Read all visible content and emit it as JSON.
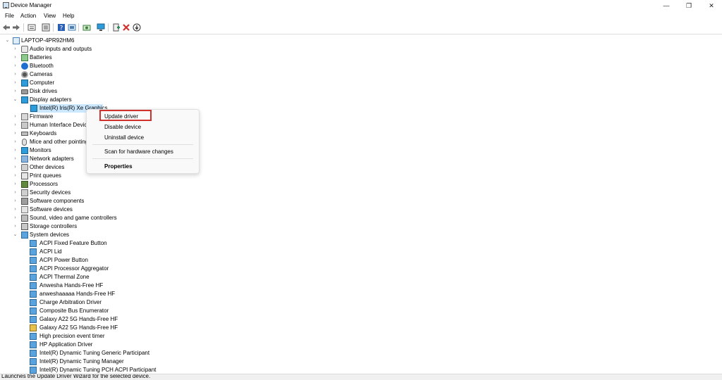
{
  "window": {
    "title": "Device Manager",
    "minimize": "—",
    "restore": "❐",
    "close": "✕"
  },
  "menu": [
    "File",
    "Action",
    "View",
    "Help"
  ],
  "toolbar": [
    "back-arrow-icon",
    "forward-arrow-icon",
    "properties-icon",
    "list-view-icon",
    "help-icon",
    "device-view-icon",
    "scan-icon",
    "monitor-icon",
    "add-driver-icon",
    "remove-device-icon",
    "download-icon"
  ],
  "tree": {
    "root": "LAPTOP-4PR92HM6",
    "categories": [
      {
        "label": "Audio inputs and outputs",
        "icon": "audio-icon",
        "expanded": false
      },
      {
        "label": "Batteries",
        "icon": "battery-icon",
        "expanded": false
      },
      {
        "label": "Bluetooth",
        "icon": "bluetooth-icon",
        "expanded": false
      },
      {
        "label": "Cameras",
        "icon": "camera-icon",
        "expanded": false
      },
      {
        "label": "Computer",
        "icon": "computer-icon",
        "expanded": false
      },
      {
        "label": "Disk drives",
        "icon": "disk-icon",
        "expanded": false
      },
      {
        "label": "Display adapters",
        "icon": "display-icon",
        "expanded": true,
        "children": [
          "Intel(R) Iris(R) Xe Graphics"
        ]
      },
      {
        "label": "Firmware",
        "icon": "firmware-icon",
        "expanded": false
      },
      {
        "label": "Human Interface Devices",
        "icon": "hid-icon",
        "expanded": false
      },
      {
        "label": "Keyboards",
        "icon": "keyboard-icon",
        "expanded": false
      },
      {
        "label": "Mice and other pointing devices",
        "icon": "mouse-icon",
        "expanded": false
      },
      {
        "label": "Monitors",
        "icon": "monitor-icon",
        "expanded": false
      },
      {
        "label": "Network adapters",
        "icon": "network-icon",
        "expanded": false
      },
      {
        "label": "Other devices",
        "icon": "other-icon",
        "expanded": false
      },
      {
        "label": "Print queues",
        "icon": "print-icon",
        "expanded": false
      },
      {
        "label": "Processors",
        "icon": "processor-icon",
        "expanded": false
      },
      {
        "label": "Security devices",
        "icon": "security-icon",
        "expanded": false
      },
      {
        "label": "Software components",
        "icon": "software-component-icon",
        "expanded": false
      },
      {
        "label": "Software devices",
        "icon": "software-device-icon",
        "expanded": false
      },
      {
        "label": "Sound, video and game controllers",
        "icon": "sound-icon",
        "expanded": false
      },
      {
        "label": "Storage controllers",
        "icon": "storage-icon",
        "expanded": false
      },
      {
        "label": "System devices",
        "icon": "system-icon",
        "expanded": true,
        "children": [
          "ACPI Fixed Feature Button",
          "ACPI Lid",
          "ACPI Power Button",
          "ACPI Processor Aggregator",
          "ACPI Thermal Zone",
          "Anwesha Hands-Free HF",
          "anweshaaaaa Hands-Free HF",
          "Charge Arbitration Driver",
          "Composite Bus Enumerator",
          "Galaxy A22 5G Hands-Free HF",
          "Galaxy A22 5G Hands-Free HF",
          "High precision event timer",
          "HP Application Driver",
          "Intel(R) Dynamic Tuning Generic Participant",
          "Intel(R) Dynamic Tuning Manager",
          "Intel(R) Dynamic Tuning PCH ACPI Participant"
        ]
      }
    ]
  },
  "context_menu": {
    "items": [
      "Update driver",
      "Disable device",
      "Uninstall device",
      "Scan for hardware changes",
      "Properties"
    ],
    "highlighted": "Update driver",
    "highlight_color": "#d0312d"
  },
  "status": "Launches the Update Driver Wizard for the selected device."
}
